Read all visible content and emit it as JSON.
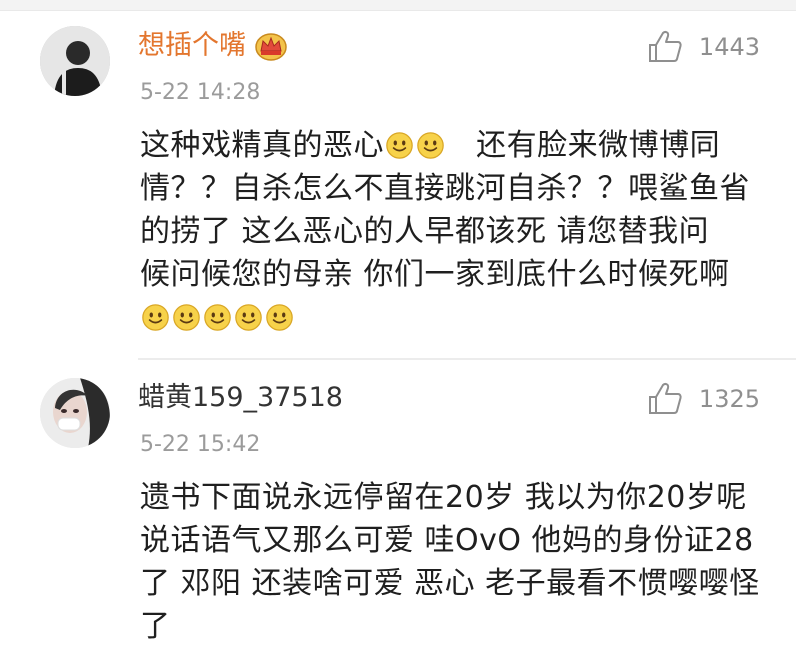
{
  "comments": [
    {
      "username": "想插个嘴",
      "badge_icon": "crown-badge-icon",
      "timestamp": "5-22 14:28",
      "likes": "1443",
      "lines": [
        "这种戏精真的恶心",
        "还有脸来微博博同",
        "情？？自杀怎么不直接跳河自杀？？喂鲨鱼省",
        "的捞了 这么恶心的人早都该死  请您替我问",
        "候问候您的母亲 你们一家到底什么时候死啊"
      ],
      "emoji_name": "smile-emoji-icon"
    },
    {
      "username": "蜡黄159_37518",
      "timestamp": "5-22 15:42",
      "likes": "1325",
      "lines": [
        "遗书下面说永远停留在20岁 我以为你20岁呢",
        "说话语气又那么可爱 哇OvO 他妈的身份证28",
        "了 邓阳 还装啥可爱 恶心 老子最看不惯嘤嘤怪",
        "了"
      ]
    }
  ],
  "colors": {
    "vip_name": "#e3762e",
    "normal_name": "#333333",
    "meta": "#9b9b9b",
    "emoji_face": "#f7d24a"
  }
}
